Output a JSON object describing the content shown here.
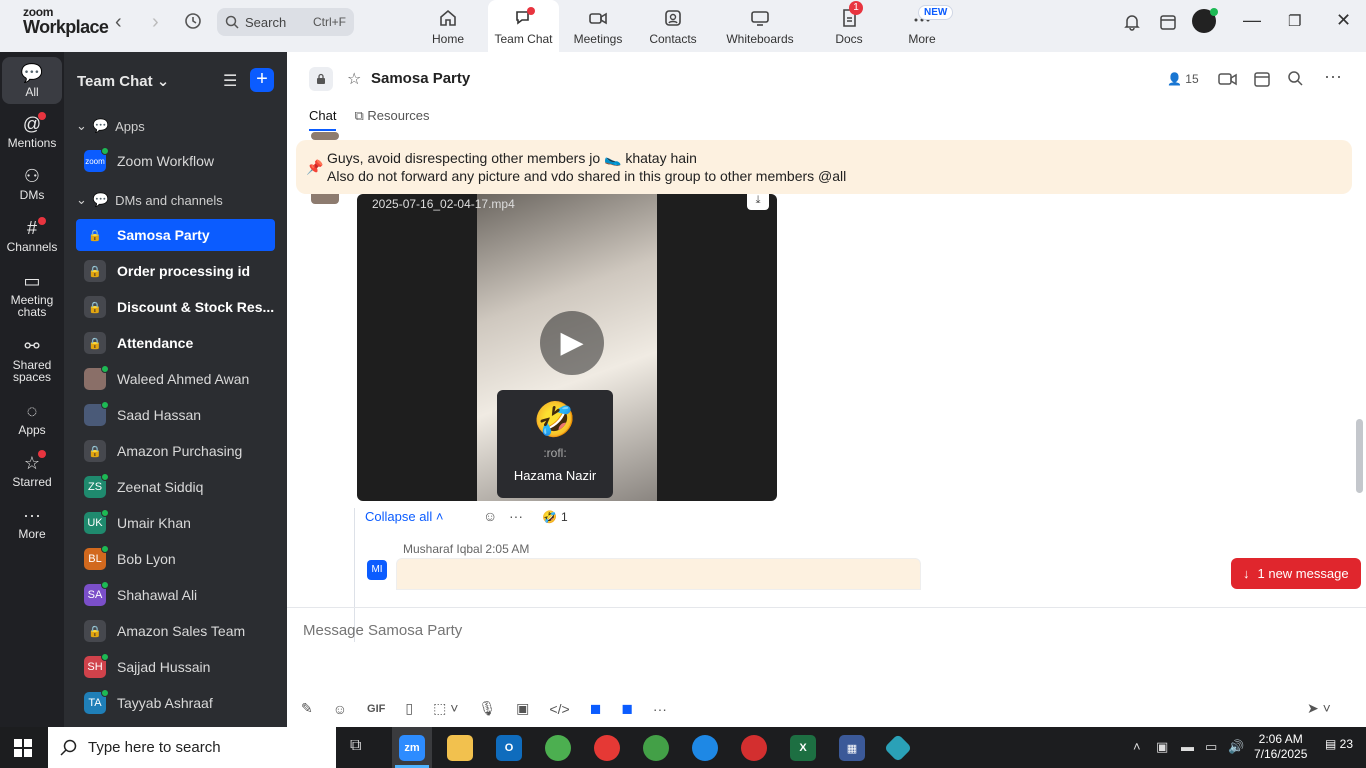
{
  "app": {
    "logo_line1": "zoom",
    "logo_line2": "Workplace",
    "search_label": "Search",
    "search_shortcut": "Ctrl+F",
    "nav": [
      {
        "label": "Home"
      },
      {
        "label": "Team Chat"
      },
      {
        "label": "Meetings"
      },
      {
        "label": "Contacts"
      },
      {
        "label": "Whiteboards"
      },
      {
        "label": "Docs",
        "badge": "1"
      },
      {
        "label": "More",
        "badge": "NEW"
      }
    ]
  },
  "rail": [
    {
      "label": "All"
    },
    {
      "label": "Mentions"
    },
    {
      "label": "DMs"
    },
    {
      "label": "Channels"
    },
    {
      "label": "Meeting chats"
    },
    {
      "label": "Shared spaces"
    },
    {
      "label": "Apps"
    },
    {
      "label": "Starred"
    },
    {
      "label": "More"
    }
  ],
  "sidebar": {
    "title": "Team Chat",
    "section_apps": "Apps",
    "app_item": "Zoom Workflow",
    "section_dms": "DMs and channels",
    "items": [
      {
        "label": "Samosa Party",
        "type": "lock",
        "selected": true
      },
      {
        "label": "Order processing id",
        "type": "lock",
        "bold": true
      },
      {
        "label": "Discount & Stock Res...",
        "type": "lock",
        "bold": true
      },
      {
        "label": "Attendance",
        "type": "lock",
        "bold": true
      },
      {
        "label": "Waleed Ahmed Awan",
        "type": "photo"
      },
      {
        "label": "Saad Hassan",
        "type": "photo"
      },
      {
        "label": "Amazon Purchasing",
        "type": "lock"
      },
      {
        "label": "Zeenat Siddiq",
        "initials": "ZS",
        "color": "#1f8a6e"
      },
      {
        "label": "Umair Khan",
        "initials": "UK",
        "color": "#1f8a6e"
      },
      {
        "label": "Bob Lyon",
        "initials": "BL",
        "color": "#d2691e"
      },
      {
        "label": "Shahawal Ali",
        "initials": "SA",
        "color": "#7b4fc9"
      },
      {
        "label": "Amazon Sales Team",
        "type": "lock"
      },
      {
        "label": "Sajjad Hussain",
        "initials": "SH",
        "color": "#d0424b"
      },
      {
        "label": "Tayyab Ashraaf",
        "initials": "TA",
        "color": "#1f7fb8"
      }
    ]
  },
  "channel": {
    "title": "Samosa Party",
    "members": "15",
    "tab_chat": "Chat",
    "tab_resources": "Resources"
  },
  "chat": {
    "pinned_line1": "Guys, avoid disrespecting other members jo 🥿 khatay hain",
    "pinned_line2": "Also do not forward any picture and vdo shared in this group to other members @all",
    "video_name": "2025-07-16_02-04-17.mp4",
    "tooltip_emoji": "🤣",
    "tooltip_code": ":rofl:",
    "tooltip_user": "Hazama Nazir",
    "collapse_label": "Collapse all",
    "reaction_emoji": "🤣",
    "reaction_count": "1",
    "reply_author": "Musharaf Iqbal",
    "reply_time": "2:05 AM",
    "reply_initials": "MI",
    "new_message": "1 new message"
  },
  "composer": {
    "placeholder": "Message Samosa Party",
    "gif": "GIF"
  },
  "taskbar": {
    "search_placeholder": "Type here to search",
    "time": "2:06 AM",
    "date": "7/16/2025",
    "notif_count": "23"
  }
}
